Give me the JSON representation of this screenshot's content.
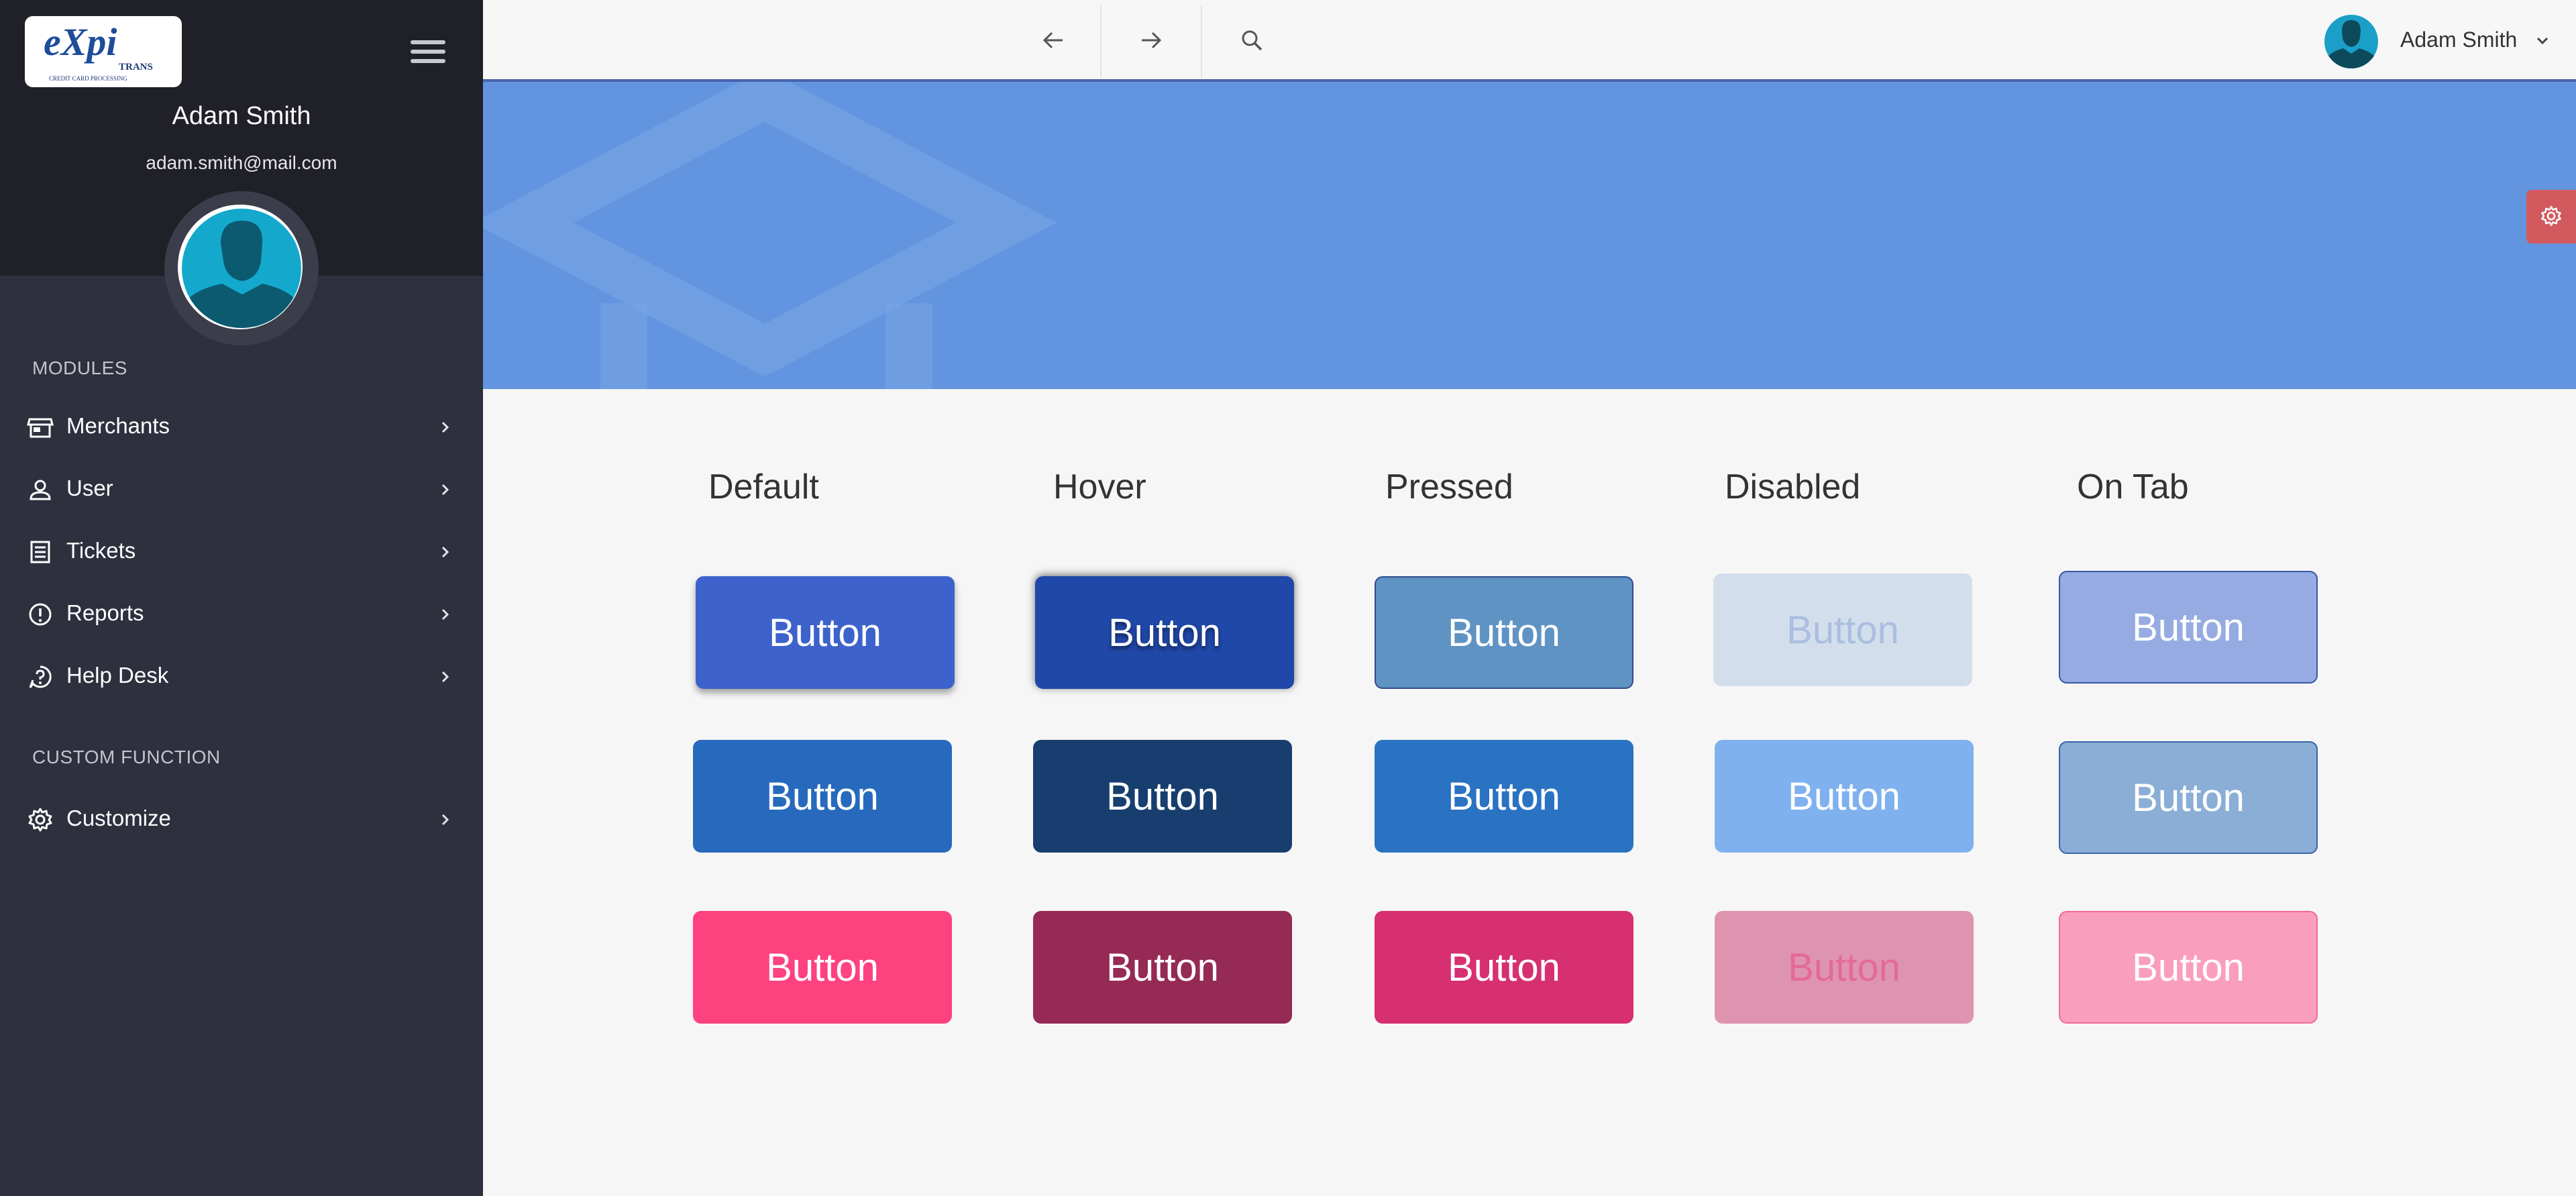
{
  "sidebar": {
    "logo": {
      "brand_text": "eXpi",
      "sub_text": "TRANS",
      "tagline": "CREDIT CARD PROCESSING"
    },
    "user": {
      "name": "Adam Smith",
      "email": "adam.smith@mail.com"
    },
    "sections": [
      {
        "label": "MODULES",
        "items": [
          {
            "label": "Merchants",
            "icon": "store-icon"
          },
          {
            "label": "User",
            "icon": "user-icon"
          },
          {
            "label": "Tickets",
            "icon": "list-icon"
          },
          {
            "label": "Reports",
            "icon": "alert-circle-icon"
          },
          {
            "label": "Help Desk",
            "icon": "help-icon"
          }
        ]
      },
      {
        "label": "CUSTOM FUNCTION",
        "items": [
          {
            "label": "Customize",
            "icon": "gear-icon"
          }
        ]
      }
    ]
  },
  "topbar": {
    "icons": [
      "arrow-left-icon",
      "arrow-right-icon",
      "search-icon"
    ],
    "user_name": "Adam Smith"
  },
  "colors": {
    "sidebar": "#2e303e",
    "sidebar_top": "#202029",
    "hero": "#6394df",
    "accent_border": "#4a64ad",
    "settings_fab": "#d25a5e"
  },
  "button_states": {
    "columns": [
      "Default",
      "Hover",
      "Pressed",
      "Disabled",
      "On Tab"
    ],
    "button_label": "Button",
    "rows": [
      {
        "name": "blue",
        "colors": [
          "#3d62cb",
          "#2048a9",
          "#5f93c3",
          "#d3deec",
          "#95abe2"
        ],
        "text_colors": [
          "#ffffff",
          "#ffffff",
          "#ffffff",
          "#a9bee0",
          "#ffffff"
        ],
        "borders": [
          "#3d62cb",
          "#2048a9",
          "#2f4c8a",
          "#d3deec",
          "#3a55a5"
        ]
      },
      {
        "name": "dark-blue",
        "colors": [
          "#276abd",
          "#173e6e",
          "#2a72c2",
          "#7fb1ef",
          "#8aaed6"
        ],
        "text_colors": [
          "#ffffff",
          "#ffffff",
          "#ffffff",
          "#ffffff",
          "#ffffff"
        ],
        "borders": [
          "#276abd",
          "#173e6e",
          "#2a72c2",
          "#7fb1ef",
          "#3a62a8"
        ]
      },
      {
        "name": "pink",
        "colors": [
          "#fd427f",
          "#952a55",
          "#d63071",
          "#de93af",
          "#fa9ebd"
        ],
        "text_colors": [
          "#ffffff",
          "#ffffff",
          "#ffffff",
          "#e46a96",
          "#ffffff"
        ],
        "borders": [
          "#fd427f",
          "#952a55",
          "#d63071",
          "#de93af",
          "#f06a9b"
        ]
      }
    ]
  }
}
